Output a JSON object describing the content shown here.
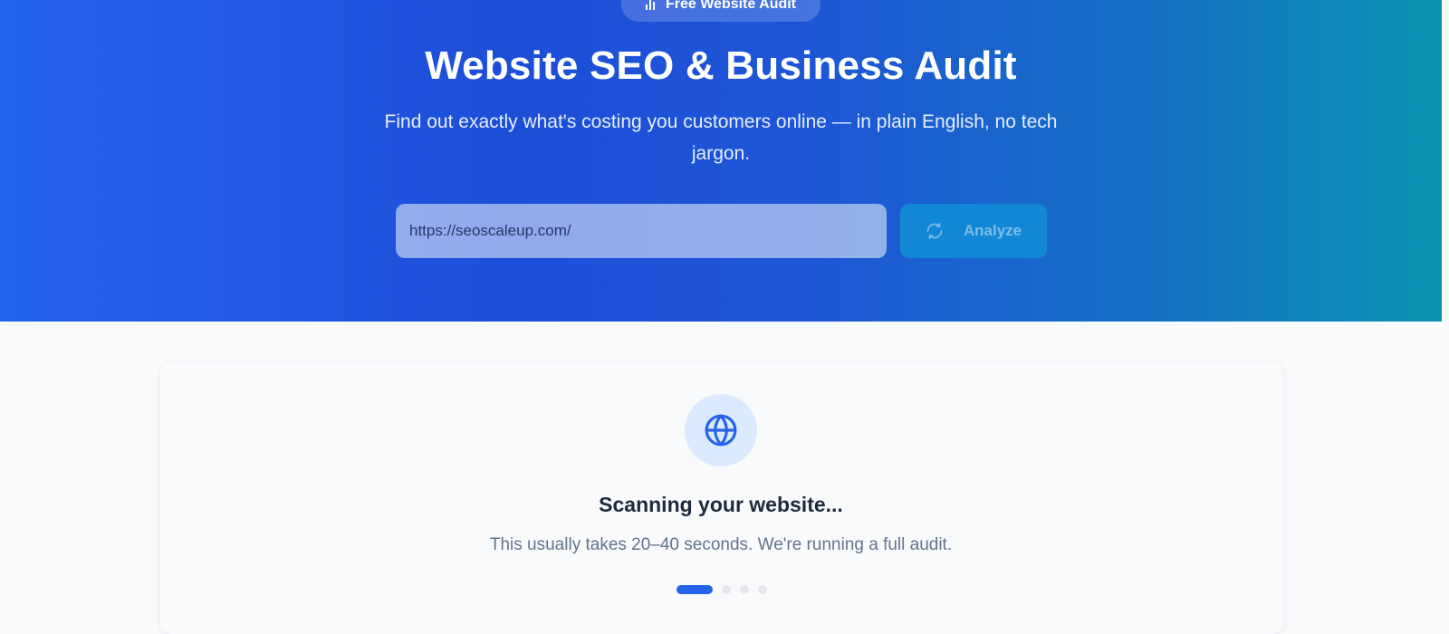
{
  "hero": {
    "badge_label": "Free Website Audit",
    "badge_icon": "bar-chart-icon",
    "title": "Website SEO & Business Audit",
    "subtitle": "Find out exactly what's costing you customers online — in plain English, no tech jargon.",
    "url_value": "https://seoscaleup.com/",
    "analyze_label": "Analyze",
    "analyze_icon": "refresh-icon"
  },
  "scan": {
    "icon": "globe-icon",
    "title": "Scanning your website...",
    "description": "This usually takes 20–40 seconds. We're running a full audit.",
    "steps_total": 4,
    "steps_active": 1
  },
  "colors": {
    "brand_blue": "#2563eb",
    "gradient_end_teal": "#0b93b0",
    "analyze_button": "#1188d6",
    "icon_circle_bg": "#dbeafe",
    "heading_text": "#1e293b",
    "muted_text": "#64748b"
  }
}
